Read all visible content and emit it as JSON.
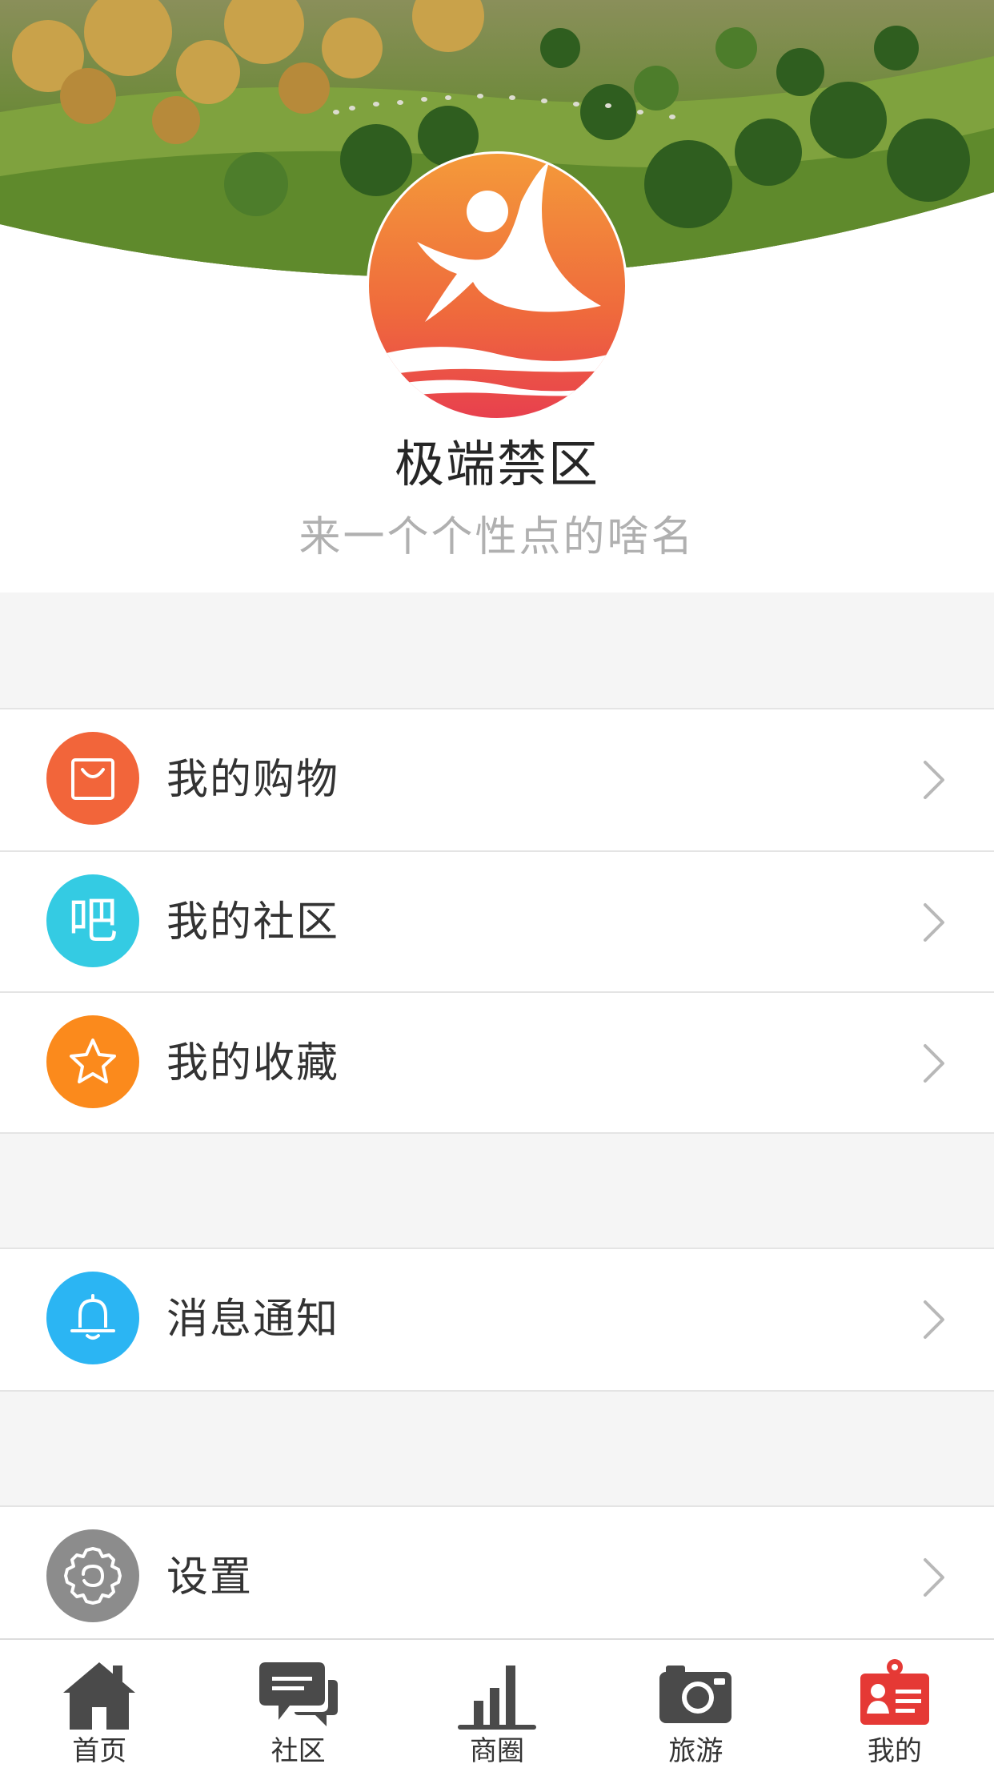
{
  "profile": {
    "username": "极端禁区",
    "signature": "来一个个性点的啥名",
    "avatar_icon": "app-logo-icon",
    "banner": "landscape-banner"
  },
  "menu_groups": [
    {
      "items": [
        {
          "label": "我的购物",
          "icon": "shopping-bag-icon",
          "color": "#f2653a"
        },
        {
          "label": "我的社区",
          "icon": "community-icon",
          "color": "#34cbe3"
        },
        {
          "label": "我的收藏",
          "icon": "star-icon",
          "color": "#fb8a1c"
        }
      ]
    },
    {
      "items": [
        {
          "label": "消息通知",
          "icon": "bell-icon",
          "color": "#2bb5f3"
        }
      ]
    },
    {
      "items": [
        {
          "label": "设置",
          "icon": "gear-icon",
          "color": "#8c8c8c"
        }
      ]
    }
  ],
  "community_icon_glyph": "吧",
  "tabbar": {
    "tabs": [
      {
        "label": "首页",
        "icon": "home-icon",
        "active": false
      },
      {
        "label": "社区",
        "icon": "chat-bubbles-icon",
        "active": false
      },
      {
        "label": "商圈",
        "icon": "bar-chart-icon",
        "active": false
      },
      {
        "label": "旅游",
        "icon": "camera-icon",
        "active": false
      },
      {
        "label": "我的",
        "icon": "profile-card-icon",
        "active": true
      }
    ],
    "inactive_color": "#4a4a4a",
    "active_color": "#e53935"
  }
}
